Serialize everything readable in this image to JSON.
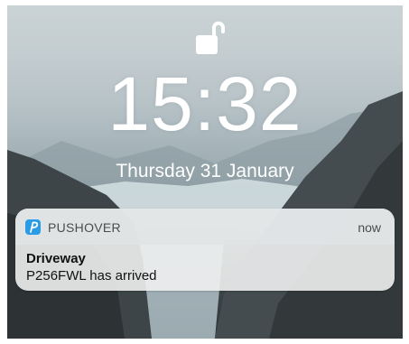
{
  "lock_screen": {
    "lock_state_icon": "unlocked-padlock-icon",
    "time": "15:32",
    "date": "Thursday 31 January"
  },
  "notification": {
    "app_icon": "pushover-logo-icon",
    "app_name": "PUSHOVER",
    "timestamp": "now",
    "title": "Driveway",
    "body": "P256FWL has arrived",
    "accent_color": "#2a9be6"
  }
}
